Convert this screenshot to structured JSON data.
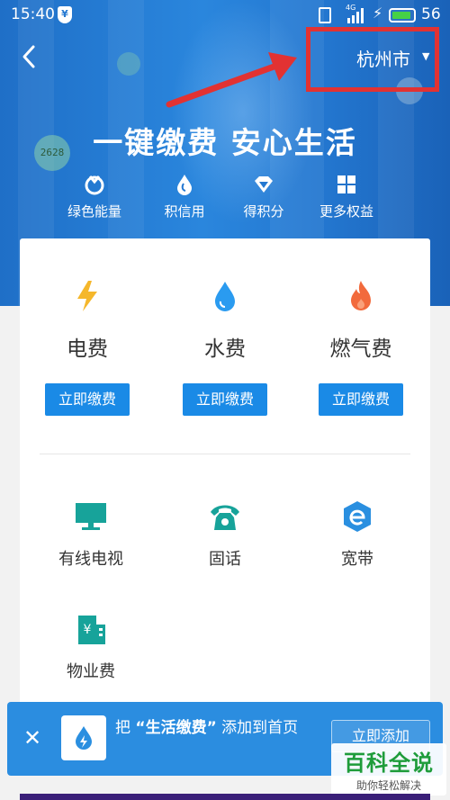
{
  "status_bar": {
    "time": "15:40",
    "network": "4G",
    "battery": "56"
  },
  "header": {
    "city": "杭州市"
  },
  "hero": {
    "slogan": "一键缴费 安心生活",
    "bubble_text": "2628",
    "features": [
      {
        "label": "绿色能量",
        "icon": "leaf-icon"
      },
      {
        "label": "积信用",
        "icon": "drop-icon"
      },
      {
        "label": "得积分",
        "icon": "diamond-icon"
      },
      {
        "label": "更多权益",
        "icon": "grid-icon"
      }
    ]
  },
  "bills": [
    {
      "name": "电费",
      "icon": "lightning-icon",
      "button": "立即缴费",
      "color": "#f5b72b"
    },
    {
      "name": "水费",
      "icon": "water-drop-icon",
      "button": "立即缴费",
      "color": "#2a9bf0"
    },
    {
      "name": "燃气费",
      "icon": "flame-icon",
      "button": "立即缴费",
      "color": "#f26a3c"
    }
  ],
  "services": [
    {
      "name": "有线电视",
      "icon": "tv-icon"
    },
    {
      "name": "固话",
      "icon": "telephone-icon"
    },
    {
      "name": "宽带",
      "icon": "broadband-icon"
    },
    {
      "name": "物业费",
      "icon": "building-icon"
    }
  ],
  "banner": {
    "prefix": "把",
    "app_name": "“生活缴费”",
    "suffix": "添加到首页",
    "add_button": "立即添加"
  },
  "watermark": {
    "title": "百科全说",
    "subtitle": "助你轻松解决"
  },
  "colors": {
    "primary": "#1a8ae6",
    "highlight": "#e23232",
    "service_icon": "#17a39a"
  }
}
